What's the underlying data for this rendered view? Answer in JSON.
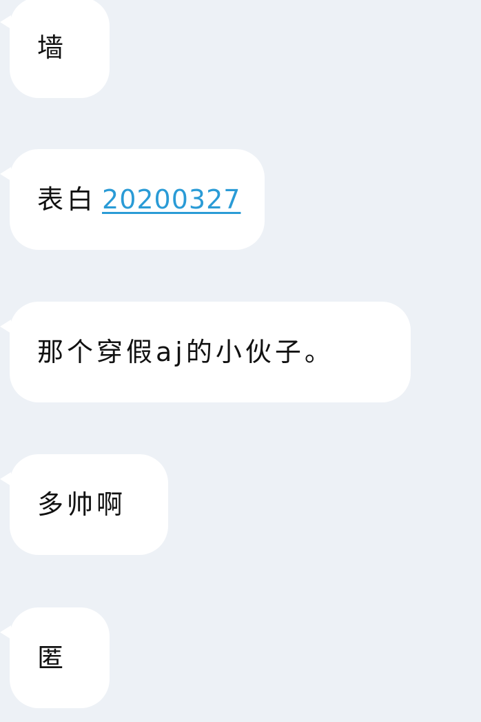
{
  "colors": {
    "background": "#edf1f6",
    "bubble": "#ffffff",
    "text": "#111111",
    "link": "#2a9bd6"
  },
  "messages": [
    {
      "text": "墙"
    },
    {
      "text": "表白",
      "link": "20200327"
    },
    {
      "text": "那个穿假aj的小伙子。"
    },
    {
      "text": "多帅啊"
    },
    {
      "text": "匿"
    }
  ]
}
